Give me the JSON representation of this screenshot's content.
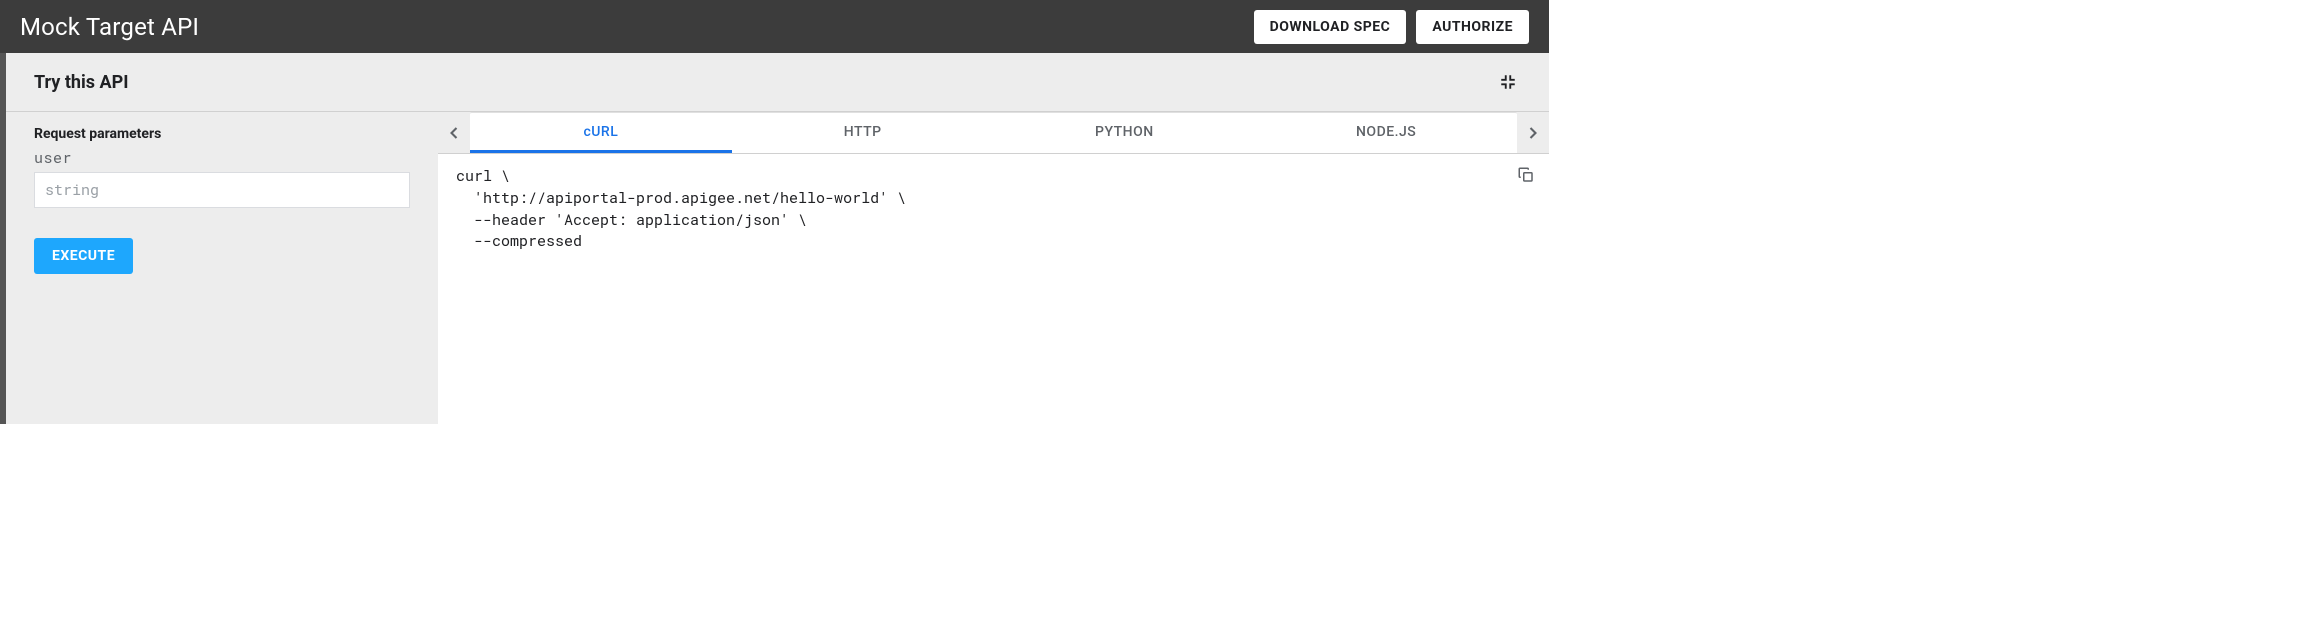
{
  "header": {
    "title": "Mock Target API",
    "download_label": "DOWNLOAD SPEC",
    "authorize_label": "AUTHORIZE"
  },
  "panel": {
    "title": "Try this API"
  },
  "request": {
    "section_label": "Request parameters",
    "param_name": "user",
    "param_placeholder": "string",
    "param_value": "",
    "execute_label": "EXECUTE"
  },
  "tabs": {
    "items": [
      "cURL",
      "HTTP",
      "PYTHON",
      "NODE.JS"
    ],
    "active_index": 0
  },
  "code": {
    "text": "curl \\\n  'http://apiportal-prod.apigee.net/hello-world' \\\n  --header 'Accept: application/json' \\\n  --compressed"
  },
  "colors": {
    "accent": "#1ea7fd",
    "tab_active": "#1a73e8",
    "header_bg": "#3c3c3c",
    "panel_bg": "#ededed"
  }
}
